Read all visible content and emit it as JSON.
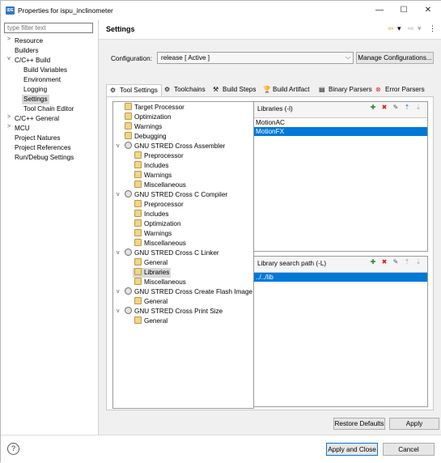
{
  "window": {
    "app_icon": "IDE",
    "title": "Properties for ispu_inclinometer",
    "minimize": "—",
    "maximize": "☐",
    "close": "✕"
  },
  "sidebar": {
    "filter_placeholder": "type filter text",
    "items": [
      {
        "label": "Resource",
        "twisty": ">"
      },
      {
        "label": "Builders",
        "twisty": ""
      },
      {
        "label": "C/C++ Build",
        "twisty": "v"
      },
      {
        "label": "Build Variables",
        "twisty": ""
      },
      {
        "label": "Environment",
        "twisty": ""
      },
      {
        "label": "Logging",
        "twisty": ""
      },
      {
        "label": "Settings",
        "twisty": ""
      },
      {
        "label": "Tool Chain Editor",
        "twisty": ""
      },
      {
        "label": "C/C++ General",
        "twisty": ">"
      },
      {
        "label": "MCU",
        "twisty": ">"
      },
      {
        "label": "Project Natures",
        "twisty": ""
      },
      {
        "label": "Project References",
        "twisty": ""
      },
      {
        "label": "Run/Debug Settings",
        "twisty": ""
      }
    ]
  },
  "header": {
    "title": "Settings",
    "back_icon": "⇦",
    "forward_icon": "⇨",
    "dropdown_icon": "▾",
    "menu_icon": "⋮"
  },
  "config": {
    "label": "Configuration:",
    "value": "release  [ Active ]",
    "manage_label": "Manage Configurations..."
  },
  "tabs": [
    {
      "label": "Tool Settings",
      "icon": "⚙"
    },
    {
      "label": "Toolchains",
      "icon": "⚙"
    },
    {
      "label": "Build Steps",
      "icon": "⚒"
    },
    {
      "label": "Build Artifact",
      "icon": "🏆"
    },
    {
      "label": "Binary Parsers",
      "icon": "▤"
    },
    {
      "label": "Error Parsers",
      "icon": "⊗"
    }
  ],
  "tool_tree": [
    "Target Processor",
    "Optimization",
    "Warnings",
    "Debugging",
    "GNU STRED Cross Assembler",
    "Preprocessor",
    "Includes",
    "Warnings",
    "Miscellaneous",
    "GNU STRED Cross C Compiler",
    "Preprocessor",
    "Includes",
    "Optimization",
    "Warnings",
    "Miscellaneous",
    "GNU STRED Cross C Linker",
    "General",
    "Libraries",
    "Miscellaneous",
    "GNU STRED Cross Create Flash Image",
    "General",
    "GNU STRED Cross Print Size",
    "General"
  ],
  "tool_tree_expand": "v",
  "libraries": {
    "header": "Libraries (-l)",
    "items": [
      "MotionAC",
      "MotionFX"
    ],
    "tool_icons": [
      "add-icon",
      "delete-icon",
      "edit-icon",
      "move-up-icon",
      "move-down-icon"
    ]
  },
  "lib_search": {
    "header": "Library search path (-L)",
    "items": [
      "../../lib"
    ]
  },
  "buttons": {
    "restore_defaults": "Restore Defaults",
    "apply": "Apply",
    "apply_close": "Apply and Close",
    "cancel": "Cancel"
  },
  "help_icon": "?"
}
